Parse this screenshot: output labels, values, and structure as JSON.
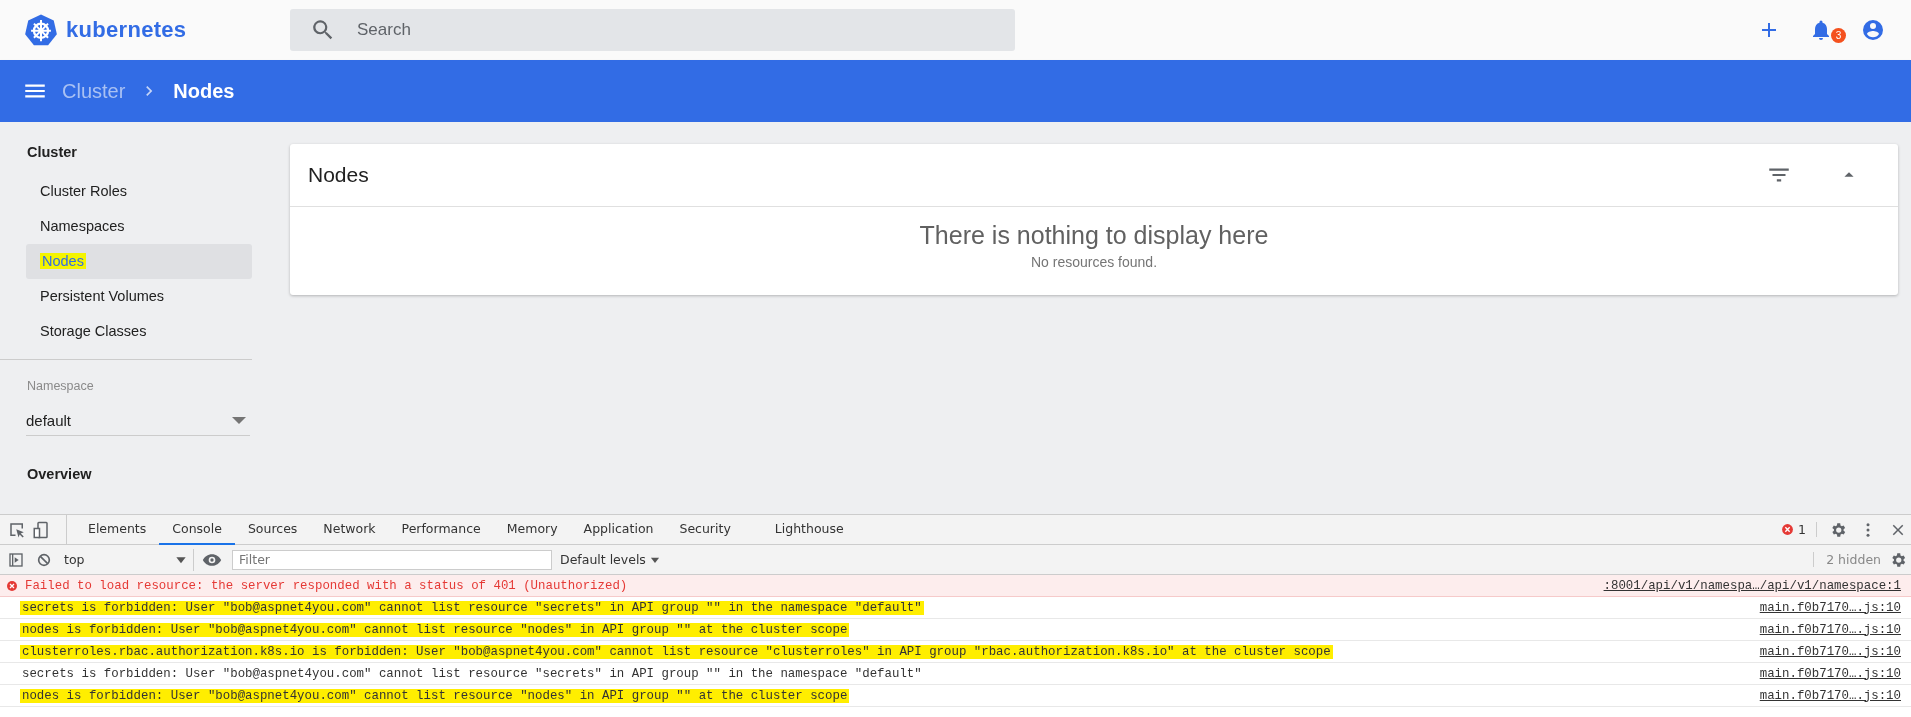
{
  "app": {
    "logo_text": "kubernetes",
    "search_placeholder": "Search",
    "notification_count": "3"
  },
  "breadcrumb": [
    {
      "label": "Cluster",
      "current": false
    },
    {
      "label": "Nodes",
      "current": true
    }
  ],
  "sidebar": {
    "heading": "Cluster",
    "items": [
      {
        "label": "Cluster Roles",
        "selected": false,
        "highlighted": false
      },
      {
        "label": "Namespaces",
        "selected": false,
        "highlighted": false
      },
      {
        "label": "Nodes",
        "selected": true,
        "highlighted": true
      },
      {
        "label": "Persistent Volumes",
        "selected": false,
        "highlighted": false
      },
      {
        "label": "Storage Classes",
        "selected": false,
        "highlighted": false
      }
    ],
    "namespace": {
      "label": "Namespace",
      "value": "default"
    },
    "section": "Overview"
  },
  "card": {
    "title": "Nodes",
    "empty_title": "There is nothing to display here",
    "empty_subtitle": "No resources found."
  },
  "devtools": {
    "tabs": [
      {
        "label": "Elements",
        "selected": false
      },
      {
        "label": "Console",
        "selected": true
      },
      {
        "label": "Sources",
        "selected": false
      },
      {
        "label": "Network",
        "selected": false
      },
      {
        "label": "Performance",
        "selected": false
      },
      {
        "label": "Memory",
        "selected": false
      },
      {
        "label": "Application",
        "selected": false
      },
      {
        "label": "Security",
        "selected": false
      },
      {
        "label": "Lighthouse",
        "selected": false
      }
    ],
    "error_count": "1",
    "context": "top",
    "filter_placeholder": "Filter",
    "levels": "Default levels",
    "hidden": "2 hidden",
    "messages": [
      {
        "kind": "error",
        "text": "Failed to load resource: the server responded with a status of 401 (Unauthorized)",
        "source": ":8001/api/v1/namespa…/api/v1/namespace:1",
        "highlighted": false
      },
      {
        "kind": "log",
        "text": "secrets is forbidden: User \"bob@aspnet4you.com\" cannot list resource \"secrets\" in API group \"\" in the namespace \"default\"",
        "source": "main.f0b7170….js:10",
        "highlighted": true
      },
      {
        "kind": "log",
        "text": "nodes is forbidden: User \"bob@aspnet4you.com\" cannot list resource \"nodes\" in API group \"\" at the cluster scope",
        "source": "main.f0b7170….js:10",
        "highlighted": true
      },
      {
        "kind": "log",
        "text": "clusterroles.rbac.authorization.k8s.io is forbidden: User \"bob@aspnet4you.com\" cannot list resource \"clusterroles\" in API group \"rbac.authorization.k8s.io\" at the cluster scope",
        "source": "main.f0b7170….js:10",
        "highlighted": true
      },
      {
        "kind": "log",
        "text": "secrets is forbidden: User \"bob@aspnet4you.com\" cannot list resource \"secrets\" in API group \"\" in the namespace \"default\"",
        "source": "main.f0b7170….js:10",
        "highlighted": false
      },
      {
        "kind": "log",
        "text": "nodes is forbidden: User \"bob@aspnet4you.com\" cannot list resource \"nodes\" in API group \"\" at the cluster scope",
        "source": "main.f0b7170….js:10",
        "highlighted": true
      }
    ]
  }
}
